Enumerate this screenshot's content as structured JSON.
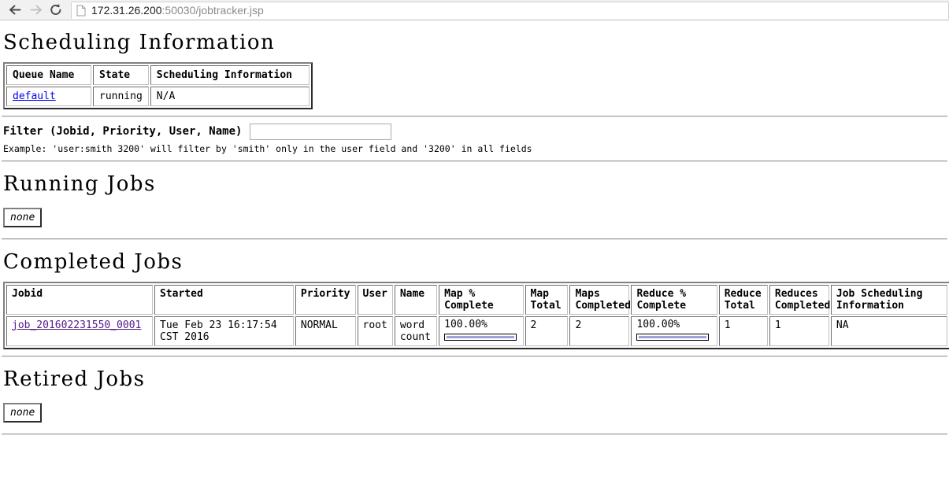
{
  "browser": {
    "back_icon": "back-arrow-icon",
    "forward_icon": "forward-arrow-icon",
    "reload_icon": "reload-icon",
    "page_icon": "page-document-icon",
    "url_host": "172.31.26.200",
    "url_rest": ":50030/jobtracker.jsp",
    "url_full": "172.31.26.200:50030/jobtracker.jsp"
  },
  "scheduling": {
    "heading": "Scheduling Information",
    "columns": [
      "Queue Name",
      "State",
      "Scheduling Information"
    ],
    "rows": [
      {
        "queue_name": "default",
        "state": "running",
        "info": "N/A"
      }
    ]
  },
  "filter": {
    "label": "Filter (Jobid, Priority, User, Name)",
    "value": "",
    "placeholder": "",
    "example": "Example: 'user:smith 3200' will filter by 'smith' only in the user field and '3200' in all fields"
  },
  "running_jobs": {
    "heading": "Running Jobs",
    "empty_label": "none"
  },
  "completed_jobs": {
    "heading": "Completed Jobs",
    "columns": [
      "Jobid",
      "Started",
      "Priority",
      "User",
      "Name",
      "Map % Complete",
      "Map Total",
      "Maps Completed",
      "Reduce % Complete",
      "Reduce Total",
      "Reduces Completed",
      "Job Scheduling Information"
    ],
    "rows": [
      {
        "jobid": "job_201602231550_0001",
        "started": "Tue Feb 23 16:17:54 CST 2016",
        "priority": "NORMAL",
        "user": "root",
        "name": "word count",
        "map_pct": "100.00%",
        "map_pct_value": 100,
        "map_total": "2",
        "maps_completed": "2",
        "reduce_pct": "100.00%",
        "reduce_pct_value": 100,
        "reduce_total": "1",
        "reduces_completed": "1",
        "scheduling_info": "NA"
      }
    ]
  },
  "retired_jobs": {
    "heading": "Retired Jobs",
    "empty_label": "none"
  },
  "colors": {
    "link": "#0000ee",
    "visited_link": "#551a8b",
    "progress_fill": "#a0a0dc",
    "chrome_bg": "#f1f1f1"
  }
}
